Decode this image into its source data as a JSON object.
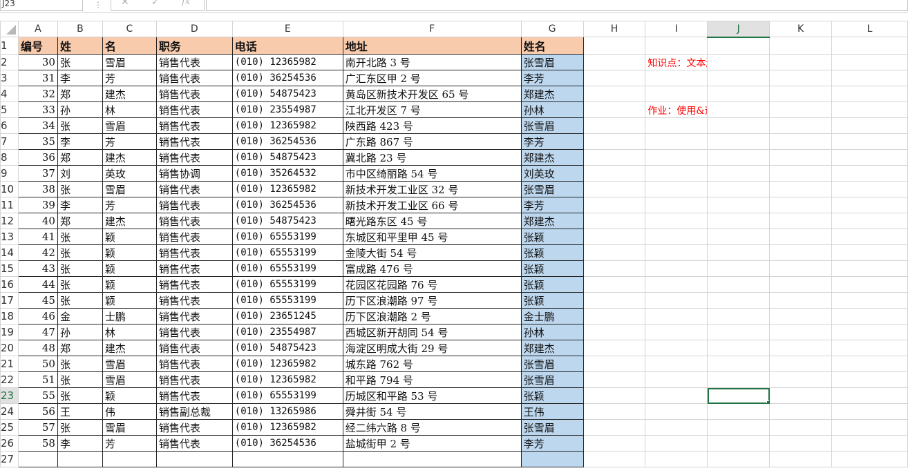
{
  "formula_bar": {
    "name_box": "J23",
    "separator": "⋮",
    "cancel_icon": "✕",
    "enter_icon": "✓",
    "fx_label": "fx",
    "formula": ""
  },
  "columns": [
    "A",
    "B",
    "C",
    "D",
    "E",
    "F",
    "G",
    "H",
    "I",
    "J",
    "K",
    "L"
  ],
  "selected_column": "J",
  "header_row": {
    "row": "1",
    "A": "编号",
    "B": "姓",
    "C": "名",
    "D": "职务",
    "E": "电话",
    "F": "地址",
    "G": "姓名"
  },
  "rows": [
    {
      "row": "2",
      "A": "30",
      "B": "张",
      "C": "雪眉",
      "D": "销售代表",
      "E": "(010) 12365982",
      "F": "南开北路 3 号",
      "G": "张雪眉"
    },
    {
      "row": "3",
      "A": "31",
      "B": "李",
      "C": "芳",
      "D": "销售代表",
      "E": "(010) 36254536",
      "F": "广汇东区甲 2 号",
      "G": "李芳"
    },
    {
      "row": "4",
      "A": "32",
      "B": "郑",
      "C": "建杰",
      "D": "销售代表",
      "E": "(010) 54875423",
      "F": "黄岛区新技术开发区 65 号",
      "G": "郑建杰"
    },
    {
      "row": "5",
      "A": "33",
      "B": "孙",
      "C": "林",
      "D": "销售代表",
      "E": "(010) 23554987",
      "F": "江北开发区 7 号",
      "G": "孙林"
    },
    {
      "row": "6",
      "A": "34",
      "B": "张",
      "C": "雪眉",
      "D": "销售代表",
      "E": "(010) 12365982",
      "F": "陕西路 423 号",
      "G": "张雪眉"
    },
    {
      "row": "7",
      "A": "35",
      "B": "李",
      "C": "芳",
      "D": "销售代表",
      "E": "(010) 36254536",
      "F": "广东路 867 号",
      "G": "李芳"
    },
    {
      "row": "8",
      "A": "36",
      "B": "郑",
      "C": "建杰",
      "D": "销售代表",
      "E": "(010) 54875423",
      "F": "冀北路 23 号",
      "G": "郑建杰"
    },
    {
      "row": "9",
      "A": "37",
      "B": "刘",
      "C": "英玫",
      "D": "销售协调",
      "E": "(010) 35264532",
      "F": "市中区绮丽路 54 号",
      "G": "刘英玫"
    },
    {
      "row": "10",
      "A": "38",
      "B": "张",
      "C": "雪眉",
      "D": "销售代表",
      "E": "(010) 12365982",
      "F": "新技术开发工业区 32 号",
      "G": "张雪眉"
    },
    {
      "row": "11",
      "A": "39",
      "B": "李",
      "C": "芳",
      "D": "销售代表",
      "E": "(010) 36254536",
      "F": "新技术开发工业区 66 号",
      "G": "李芳"
    },
    {
      "row": "12",
      "A": "40",
      "B": "郑",
      "C": "建杰",
      "D": "销售代表",
      "E": "(010) 54875423",
      "F": "曙光路东区 45 号",
      "G": "郑建杰"
    },
    {
      "row": "13",
      "A": "41",
      "B": "张",
      "C": "颖",
      "D": "销售代表",
      "E": "(010) 65553199",
      "F": "东城区和平里甲 45 号",
      "G": "张颖"
    },
    {
      "row": "14",
      "A": "42",
      "B": "张",
      "C": "颖",
      "D": "销售代表",
      "E": "(010) 65553199",
      "F": "金陵大街 54 号",
      "G": "张颖"
    },
    {
      "row": "15",
      "A": "43",
      "B": "张",
      "C": "颖",
      "D": "销售代表",
      "E": "(010) 65553199",
      "F": "富成路 476 号",
      "G": "张颖"
    },
    {
      "row": "16",
      "A": "44",
      "B": "张",
      "C": "颖",
      "D": "销售代表",
      "E": "(010) 65553199",
      "F": "花园区花园路 76 号",
      "G": "张颖"
    },
    {
      "row": "17",
      "A": "45",
      "B": "张",
      "C": "颖",
      "D": "销售代表",
      "E": "(010) 65553199",
      "F": "历下区浪潮路 97 号",
      "G": "张颖"
    },
    {
      "row": "18",
      "A": "46",
      "B": "金",
      "C": "士鹏",
      "D": "销售代表",
      "E": "(010) 23651245",
      "F": "历下区浪潮路 2 号",
      "G": "金士鹏"
    },
    {
      "row": "19",
      "A": "47",
      "B": "孙",
      "C": "林",
      "D": "销售代表",
      "E": "(010) 23554987",
      "F": "西城区新开胡同 54 号",
      "G": "孙林"
    },
    {
      "row": "20",
      "A": "48",
      "B": "郑",
      "C": "建杰",
      "D": "销售代表",
      "E": "(010) 54875423",
      "F": "海淀区明成大街 29 号",
      "G": "郑建杰"
    },
    {
      "row": "21",
      "A": "50",
      "B": "张",
      "C": "雪眉",
      "D": "销售代表",
      "E": "(010) 12365982",
      "F": "城东路 762 号",
      "G": "张雪眉"
    },
    {
      "row": "22",
      "A": "51",
      "B": "张",
      "C": "雪眉",
      "D": "销售代表",
      "E": "(010) 12365982",
      "F": "和平路 794 号",
      "G": "张雪眉"
    },
    {
      "row": "23",
      "A": "55",
      "B": "张",
      "C": "颖",
      "D": "销售代表",
      "E": "(010) 65553199",
      "F": "历城区和平路 53 号",
      "G": "张颖"
    },
    {
      "row": "24",
      "A": "56",
      "B": "王",
      "C": "伟",
      "D": "销售副总裁",
      "E": "(010) 13265986",
      "F": "舜井街 54 号",
      "G": "王伟"
    },
    {
      "row": "25",
      "A": "57",
      "B": "张",
      "C": "雪眉",
      "D": "销售代表",
      "E": "(010) 12365982",
      "F": "经二纬六路 8 号",
      "G": "张雪眉"
    },
    {
      "row": "26",
      "A": "58",
      "B": "李",
      "C": "芳",
      "D": "销售代表",
      "E": "(010) 36254536",
      "F": "盐城街甲 2 号",
      "G": "李芳"
    }
  ],
  "notes": {
    "knowledge": "知识点：文本连接运算符&使用。",
    "homework": "作业：使用&运算符合并姓与名列的数据。"
  },
  "active_cell": "J23",
  "colors": {
    "header_fill": "#f8cbad",
    "name_fill": "#bdd7ee",
    "note_text": "#ff0000",
    "selection": "#217346"
  }
}
